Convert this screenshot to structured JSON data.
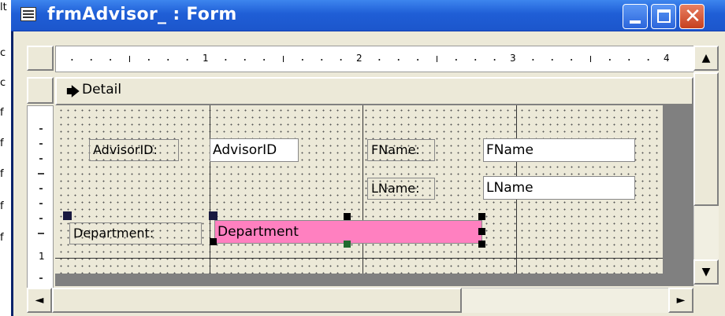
{
  "background_window": {
    "edge_letters": [
      "lt",
      "c",
      "c",
      "f",
      "f",
      "f",
      "f",
      "f"
    ]
  },
  "window": {
    "title": "frmAdvisor_ : Form",
    "controls": {
      "minimize": "_",
      "maximize": "□",
      "close": "✕"
    }
  },
  "ruler": {
    "numbers": [
      "1",
      "2",
      "3",
      "4"
    ],
    "vertical_number": "1"
  },
  "section": {
    "label": "Detail"
  },
  "form_controls": {
    "advisorid_label": "AdvisorID:",
    "advisorid_field": "AdvisorID",
    "fname_label": "FName:",
    "fname_field": "FName",
    "lname_label": "LName:",
    "lname_field": "LName",
    "department_label": "Department:",
    "department_field": "Department"
  },
  "scroll": {
    "up": "▲",
    "down": "▼",
    "left": "◄",
    "right": "►"
  },
  "colors": {
    "titlebar": "#1f5ed6",
    "selected_field": "#ff80c0",
    "design_grid": "#ece9d8"
  }
}
